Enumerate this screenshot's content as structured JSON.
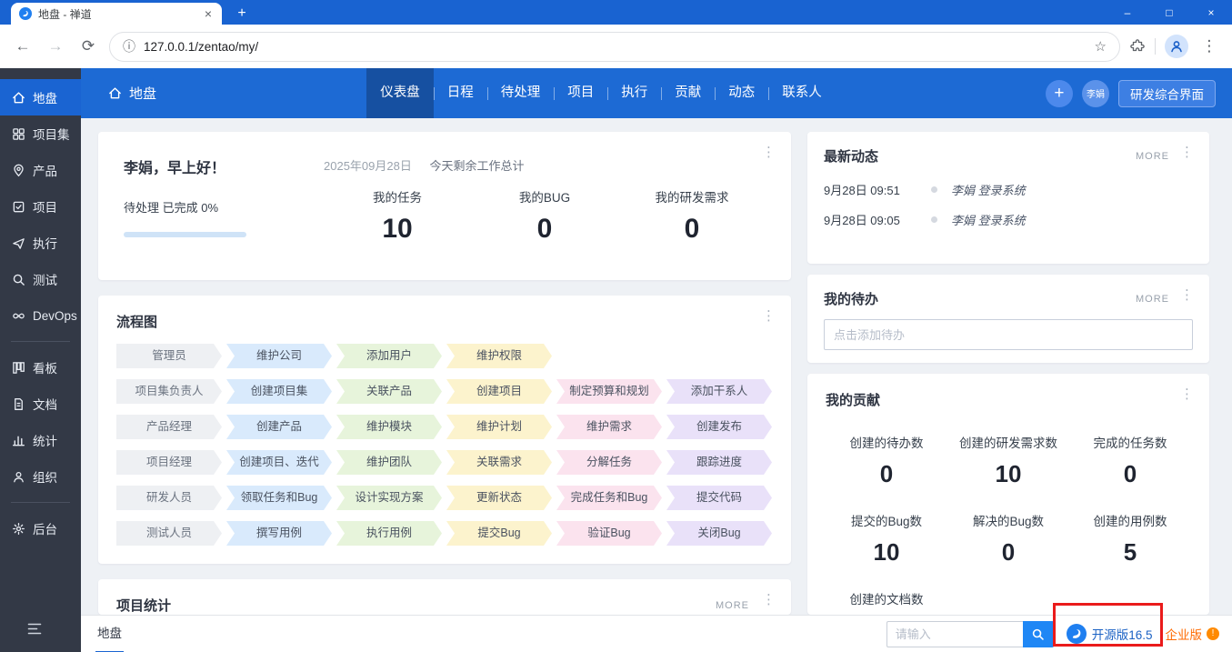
{
  "colors": {
    "accent_blue": "#1d6ad4",
    "titlebar_blue": "#1963d1",
    "sidebar_bg": "#333946",
    "active_item_blue": "#1a64d2",
    "flow_role_bg": "#eef0f3",
    "flow_step_colors": [
      "#d9eafc",
      "#e7f4db",
      "#fcf3cd",
      "#fbe3ee",
      "#e9e1f9"
    ],
    "search_button_blue": "#1f87f5",
    "enterprise_orange": "#ff6a00",
    "annotation_red": "#ea1b1b"
  },
  "icons": {
    "back": "←",
    "forward": "→",
    "reload": "⟳",
    "info": "ⓘ",
    "star": "☆",
    "kebab": "⋮",
    "tab_close": "×",
    "new_tab": "+",
    "win_min": "–",
    "win_max": "□",
    "win_close": "×",
    "plus": "+",
    "badge": "!"
  },
  "browser": {
    "tab_title": "地盘 - 禅道",
    "url": "127.0.0.1/zentao/my/"
  },
  "sidebar": {
    "items": [
      {
        "label": "地盘"
      },
      {
        "label": "项目集"
      },
      {
        "label": "产品"
      },
      {
        "label": "项目"
      },
      {
        "label": "执行"
      },
      {
        "label": "测试"
      },
      {
        "label": "DevOps"
      },
      {
        "label": "看板"
      },
      {
        "label": "文档"
      },
      {
        "label": "统计"
      },
      {
        "label": "组织"
      },
      {
        "label": "后台"
      }
    ]
  },
  "topnav": {
    "title": "地盘",
    "items": [
      {
        "label": "仪表盘"
      },
      {
        "label": "日程"
      },
      {
        "label": "待处理"
      },
      {
        "label": "项目"
      },
      {
        "label": "执行"
      },
      {
        "label": "贡献"
      },
      {
        "label": "动态"
      },
      {
        "label": "联系人"
      }
    ],
    "user": "李娟",
    "action": "研发综合界面"
  },
  "welcome": {
    "greeting": "李娟，早上好！",
    "pending": "待处理 已完成 0%",
    "date": "2025年09月28日",
    "summary": "今天剩余工作总计",
    "stats": [
      {
        "label": "我的任务",
        "value": "10"
      },
      {
        "label": "我的BUG",
        "value": "0"
      },
      {
        "label": "我的研发需求",
        "value": "0"
      }
    ]
  },
  "flowchart": {
    "title": "流程图",
    "rows": [
      {
        "role": "管理员",
        "steps": [
          "维护公司",
          "添加用户",
          "维护权限"
        ]
      },
      {
        "role": "项目集负责人",
        "steps": [
          "创建项目集",
          "关联产品",
          "创建项目",
          "制定预算和规划",
          "添加干系人"
        ]
      },
      {
        "role": "产品经理",
        "steps": [
          "创建产品",
          "维护模块",
          "维护计划",
          "维护需求",
          "创建发布"
        ]
      },
      {
        "role": "项目经理",
        "steps": [
          "创建项目、迭代",
          "维护团队",
          "关联需求",
          "分解任务",
          "跟踪进度"
        ]
      },
      {
        "role": "研发人员",
        "steps": [
          "领取任务和Bug",
          "设计实现方案",
          "更新状态",
          "完成任务和Bug",
          "提交代码"
        ]
      },
      {
        "role": "测试人员",
        "steps": [
          "撰写用例",
          "执行用例",
          "提交Bug",
          "验证Bug",
          "关闭Bug"
        ]
      }
    ]
  },
  "project_stats": {
    "title": "项目统计",
    "more": "MORE"
  },
  "news": {
    "title": "最新动态",
    "more": "MORE",
    "entries": [
      {
        "time": "9月28日 09:51",
        "action": "李娟 登录系统"
      },
      {
        "time": "9月28日 09:05",
        "action": "李娟 登录系统"
      }
    ]
  },
  "todo": {
    "title": "我的待办",
    "more": "MORE",
    "placeholder": "点击添加待办"
  },
  "contribution": {
    "title": "我的贡献",
    "stats": [
      {
        "label": "创建的待办数",
        "value": "0"
      },
      {
        "label": "创建的研发需求数",
        "value": "10"
      },
      {
        "label": "完成的任务数",
        "value": "0"
      },
      {
        "label": "提交的Bug数",
        "value": "10"
      },
      {
        "label": "解决的Bug数",
        "value": "0"
      },
      {
        "label": "创建的用例数",
        "value": "5"
      },
      {
        "label": "创建的文档数",
        "value": ""
      }
    ]
  },
  "statusbar": {
    "tab": "地盘",
    "search_placeholder": "请输入",
    "version": "开源版16.5",
    "enterprise": "企业版"
  }
}
